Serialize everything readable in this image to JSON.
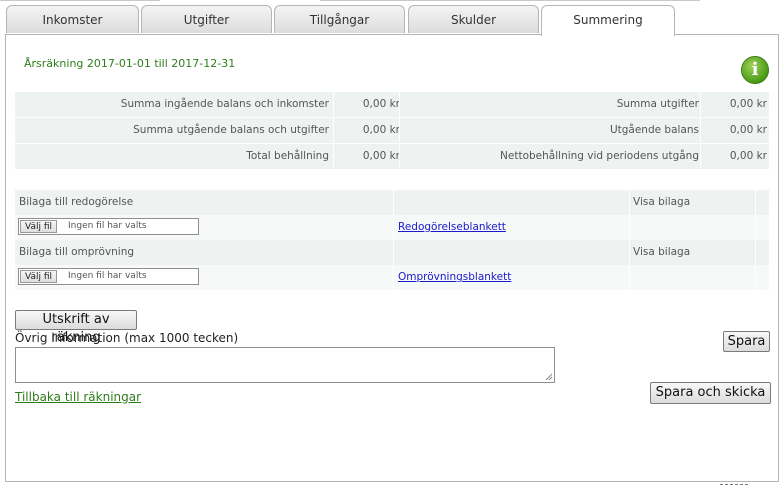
{
  "tabs": [
    {
      "label": "Inkomster",
      "active": false
    },
    {
      "label": "Utgifter",
      "active": false
    },
    {
      "label": "Tillgångar",
      "active": false
    },
    {
      "label": "Skulder",
      "active": false
    },
    {
      "label": "Summering",
      "active": true
    }
  ],
  "period": "Årsräkning 2017-01-01 till 2017-12-31",
  "info_icon": {
    "glyph": "i",
    "name": "info-icon",
    "color": "#4a9a16"
  },
  "summary": [
    {
      "left_label": "Summa ingående balans och inkomster",
      "left_value": "0,00 kr",
      "right_label": "Summa utgifter",
      "right_value": "0,00 kr"
    },
    {
      "left_label": "Summa utgående balans och utgifter",
      "left_value": "0,00 kr",
      "right_label": "Utgående balans",
      "right_value": "0,00 kr"
    },
    {
      "left_label": "Total behållning",
      "left_value": "0,00 kr",
      "right_label": "Nettobehållning vid periodens utgång",
      "right_value": "0,00 kr"
    }
  ],
  "attachments": [
    {
      "title": "Bilaga till redogörelse",
      "show_label": "Visa bilaga",
      "file_button": "Välj fil",
      "file_status": "Ingen fil har valts",
      "form_link": "Redogörelseblankett"
    },
    {
      "title": "Bilaga till omprövning",
      "show_label": "Visa bilaga",
      "file_button": "Välj fil",
      "file_status": "Ingen fil har valts",
      "form_link": "Omprövningsblankett"
    }
  ],
  "print_button": "Utskrift av räkning",
  "other_info_label": "Övrig information (max 1000 tecken)",
  "other_info_value": "",
  "save_button": "Spara",
  "save_send_button": "Spara och skicka",
  "back_link": "Tillbaka till räkningar",
  "colors": {
    "accent_green": "#2e7d1b",
    "link_blue": "#1a1acc",
    "row_bg": "#eef3f2"
  }
}
